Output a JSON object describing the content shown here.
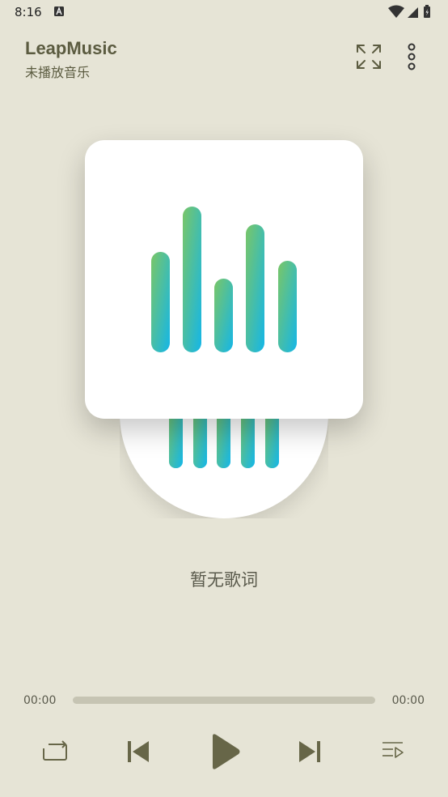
{
  "status_bar": {
    "time": "8:16"
  },
  "header": {
    "title": "LeapMusic",
    "subtitle": "未播放音乐"
  },
  "lyrics": {
    "text": "暂无歌词"
  },
  "player": {
    "current_time": "00:00",
    "total_time": "00:00",
    "progress": 0
  },
  "controls": [
    "repeat-icon",
    "skip-previous-icon",
    "play-icon",
    "skip-next-icon",
    "playlist-icon"
  ],
  "colors": {
    "background": "#e6e4d6",
    "text": "#5b5b40",
    "control": "#676648",
    "gradient_start": "#7ac667",
    "gradient_end": "#14b6e8"
  }
}
